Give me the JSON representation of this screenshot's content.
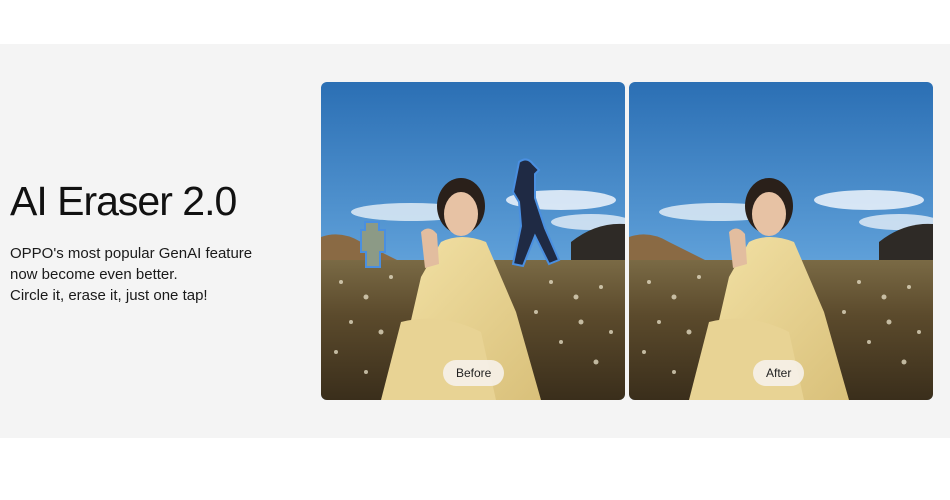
{
  "feature": {
    "title": "AI Eraser 2.0",
    "description_lines": [
      "OPPO's most popular GenAI feature",
      "now become even better.",
      "Circle it, erase it, just one tap!"
    ]
  },
  "comparison": {
    "before_label": "Before",
    "after_label": "After"
  },
  "colors": {
    "band": "#f4f4f4",
    "sky_top": "#2b6fb4",
    "sky_bottom": "#8cc0e6",
    "selection_outline": "#4a8fe0",
    "pill_bg": "#f5f0e8"
  }
}
